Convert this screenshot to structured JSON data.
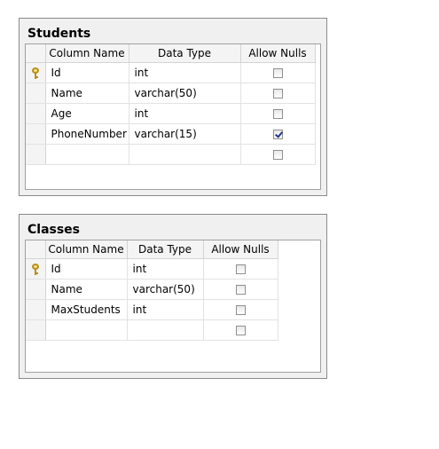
{
  "tables": [
    {
      "title": "Students",
      "headers": {
        "column_name": "Column Name",
        "data_type": "Data Type",
        "allow_nulls": "Allow Nulls"
      },
      "rows": [
        {
          "name": "Id",
          "type": "int",
          "allow_nulls": false,
          "primary_key": true
        },
        {
          "name": "Name",
          "type": "varchar(50)",
          "allow_nulls": false,
          "primary_key": false
        },
        {
          "name": "Age",
          "type": "int",
          "allow_nulls": false,
          "primary_key": false
        },
        {
          "name": "PhoneNumber",
          "type": "varchar(15)",
          "allow_nulls": true,
          "primary_key": false
        },
        {
          "name": "",
          "type": "",
          "allow_nulls": false,
          "primary_key": false
        }
      ]
    },
    {
      "title": "Classes",
      "headers": {
        "column_name": "Column Name",
        "data_type": "Data Type",
        "allow_nulls": "Allow Nulls"
      },
      "rows": [
        {
          "name": "Id",
          "type": "int",
          "allow_nulls": false,
          "primary_key": true
        },
        {
          "name": "Name",
          "type": "varchar(50)",
          "allow_nulls": false,
          "primary_key": false
        },
        {
          "name": "MaxStudents",
          "type": "int",
          "allow_nulls": false,
          "primary_key": false
        },
        {
          "name": "",
          "type": "",
          "allow_nulls": false,
          "primary_key": false
        }
      ]
    }
  ]
}
